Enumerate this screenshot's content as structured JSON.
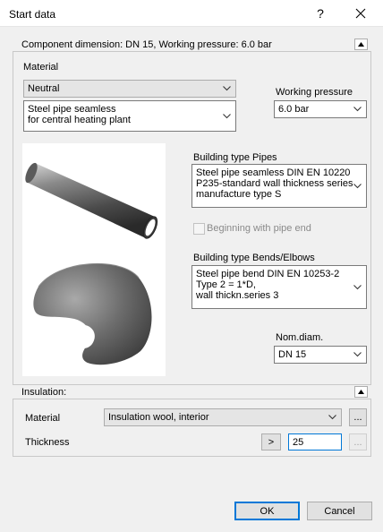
{
  "window": {
    "title": "Start data",
    "help_label": "?",
    "close_label": "close"
  },
  "component_group": {
    "caption": "Component dimension: DN 15, Working pressure: 6.0 bar",
    "material_label": "Material",
    "material_value": "Neutral",
    "material_type_value": "Steel pipe seamless\nfor central heating plant",
    "working_pressure_label": "Working pressure",
    "working_pressure_value": "6.0 bar",
    "building_type_pipes_label": "Building type Pipes",
    "building_type_pipes_value": "Steel pipe seamless DIN EN 10220\nP235-standard wall thickness series\nmanufacture type S",
    "beginning_with_pipe_end_label": "Beginning with pipe end",
    "beginning_with_pipe_end_checked": false,
    "building_type_bends_label": "Building type Bends/Elbows",
    "building_type_bends_value": "Steel pipe bend DIN EN 10253-2\nType 2 = 1*D,\nwall thickn.series 3",
    "nom_diam_label": "Nom.diam.",
    "nom_diam_value": "DN 15"
  },
  "insulation_group": {
    "caption": "Insulation:",
    "material_label": "Material",
    "material_value": "Insulation wool, interior",
    "browse_label": "...",
    "thickness_label": "Thickness",
    "arrow_button_label": ">",
    "thickness_value": "25",
    "thickness_browse_label": "..."
  },
  "buttons": {
    "ok": "OK",
    "cancel": "Cancel"
  },
  "colors": {
    "accent": "#0078d7",
    "dialog_bg": "#f0f0f0"
  }
}
